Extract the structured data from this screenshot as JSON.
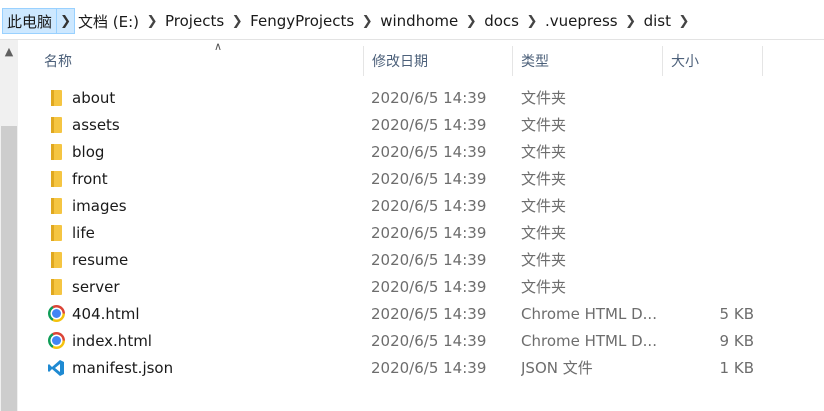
{
  "breadcrumb": {
    "root": "此电脑",
    "segments": [
      "文档 (E:)",
      "Projects",
      "FengyProjects",
      "windhome",
      "docs",
      ".vuepress",
      "dist"
    ]
  },
  "columns": {
    "name": "名称",
    "modified": "修改日期",
    "type": "类型",
    "size": "大小"
  },
  "files": [
    {
      "icon": "folder-icon",
      "name": "about",
      "modified": "2020/6/5 14:39",
      "type": "文件夹",
      "size": ""
    },
    {
      "icon": "folder-icon",
      "name": "assets",
      "modified": "2020/6/5 14:39",
      "type": "文件夹",
      "size": ""
    },
    {
      "icon": "folder-icon",
      "name": "blog",
      "modified": "2020/6/5 14:39",
      "type": "文件夹",
      "size": ""
    },
    {
      "icon": "folder-icon",
      "name": "front",
      "modified": "2020/6/5 14:39",
      "type": "文件夹",
      "size": ""
    },
    {
      "icon": "folder-icon",
      "name": "images",
      "modified": "2020/6/5 14:39",
      "type": "文件夹",
      "size": ""
    },
    {
      "icon": "folder-icon",
      "name": "life",
      "modified": "2020/6/5 14:39",
      "type": "文件夹",
      "size": ""
    },
    {
      "icon": "folder-icon",
      "name": "resume",
      "modified": "2020/6/5 14:39",
      "type": "文件夹",
      "size": ""
    },
    {
      "icon": "folder-icon",
      "name": "server",
      "modified": "2020/6/5 14:39",
      "type": "文件夹",
      "size": ""
    },
    {
      "icon": "chrome-icon",
      "name": "404.html",
      "modified": "2020/6/5 14:39",
      "type": "Chrome HTML D...",
      "size": "5 KB"
    },
    {
      "icon": "chrome-icon",
      "name": "index.html",
      "modified": "2020/6/5 14:39",
      "type": "Chrome HTML D...",
      "size": "9 KB"
    },
    {
      "icon": "vscode-icon",
      "name": "manifest.json",
      "modified": "2020/6/5 14:39",
      "type": "JSON 文件",
      "size": "1 KB"
    }
  ],
  "colors": {
    "selected_crumb_bg": "#cde8ff",
    "header_text": "#4c607a",
    "folder": "#f5c542"
  }
}
